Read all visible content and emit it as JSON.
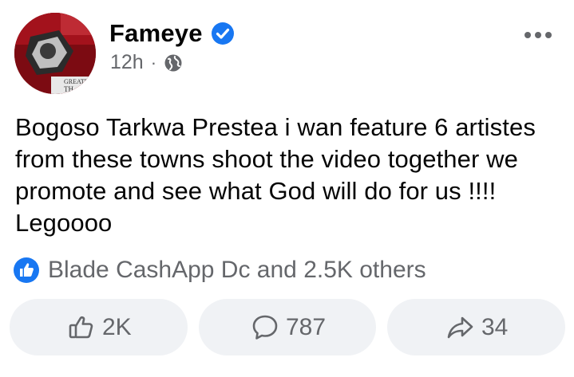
{
  "post": {
    "author": "Fameye",
    "verified": true,
    "time": "12h",
    "separator": "·",
    "privacy_icon": "globe-icon",
    "text": "Bogoso Tarkwa Prestea i wan feature 6 artistes from these towns shoot the video together we promote and see what God will do for us !!!! Legoooo",
    "avatar_caption_1": "GREATER",
    "avatar_caption_2": "TH"
  },
  "reactions": {
    "icon": "like-icon",
    "text": "Blade CashApp Dc and 2.5K others"
  },
  "actions": {
    "like_count": "2K",
    "comment_count": "787",
    "share_count": "34"
  },
  "colors": {
    "verified_blue": "#1877f2",
    "secondary_text": "#65676b",
    "button_bg": "#f0f2f5",
    "avatar_red": "#8a0d14"
  }
}
